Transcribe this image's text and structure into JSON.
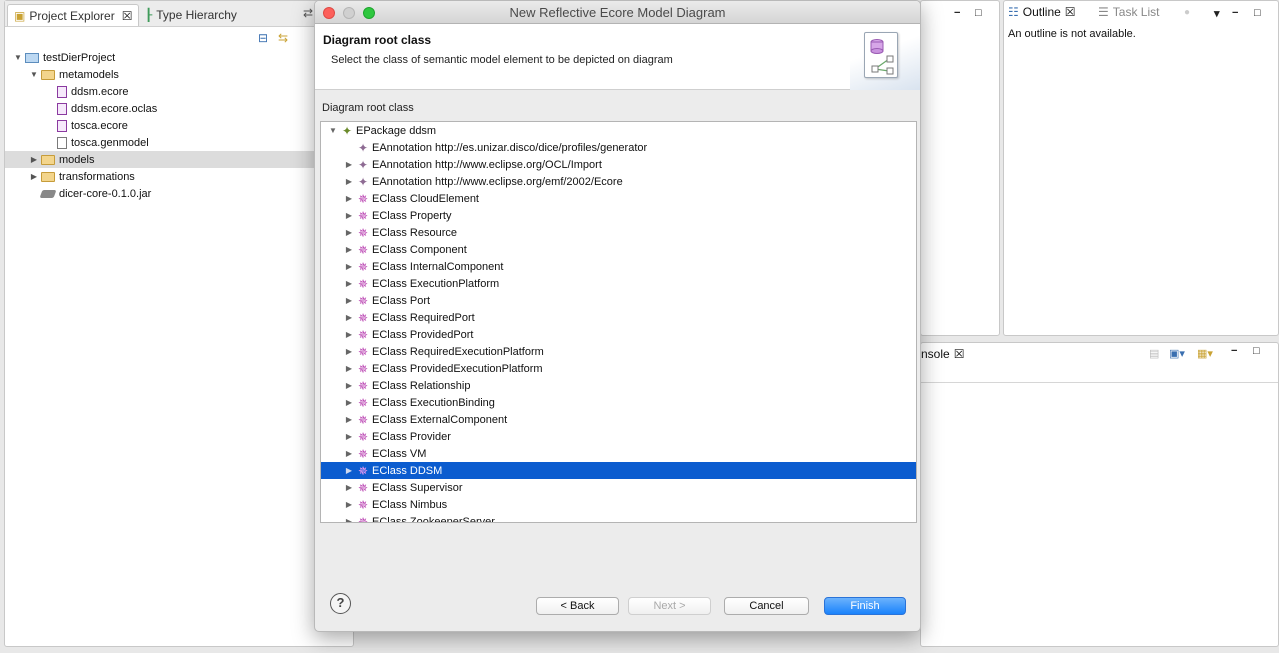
{
  "ide": {
    "left_tabs": [
      {
        "label": "Project Explorer",
        "icon": "project-explorer-icon",
        "active": true
      },
      {
        "label": "Type Hierarchy",
        "icon": "type-hierarchy-icon",
        "active": false
      }
    ],
    "explorer_tree": [
      {
        "label": "testDierProject",
        "level": 0,
        "twisty": "expanded",
        "icon": "project-icon"
      },
      {
        "label": "metamodels",
        "level": 1,
        "twisty": "expanded",
        "icon": "folder-icon"
      },
      {
        "label": "ddsm.ecore",
        "level": 2,
        "twisty": "none",
        "icon": "ecore-file-icon"
      },
      {
        "label": "ddsm.ecore.oclas",
        "level": 2,
        "twisty": "none",
        "icon": "ecore-diagram-icon"
      },
      {
        "label": "tosca.ecore",
        "level": 2,
        "twisty": "none",
        "icon": "ecore-file-icon"
      },
      {
        "label": "tosca.genmodel",
        "level": 2,
        "twisty": "none",
        "icon": "genmodel-file-icon"
      },
      {
        "label": "models",
        "level": 1,
        "twisty": "collapsed",
        "icon": "folder-icon",
        "highlight": true
      },
      {
        "label": "transformations",
        "level": 1,
        "twisty": "collapsed",
        "icon": "folder-icon"
      },
      {
        "label": "dicer-core-0.1.0.jar",
        "level": 1,
        "twisty": "none",
        "icon": "jar-icon"
      }
    ],
    "right_tabs": [
      {
        "label": "Outline",
        "active": true
      },
      {
        "label": "Task List",
        "active": false
      }
    ],
    "outline_message": "An outline is not available.",
    "console_tab_label": "nsole"
  },
  "dialog": {
    "window_title": "New Reflective Ecore Model Diagram",
    "banner_title": "Diagram root class",
    "banner_description": "Select the class of semantic model element to be depicted on diagram",
    "section_label": "Diagram root class",
    "tree": [
      {
        "label": "EPackage ddsm",
        "level": 0,
        "twisty": "expanded",
        "kind": "package"
      },
      {
        "label": "EAnnotation http://es.unizar.disco/dice/profiles/generator",
        "level": 1,
        "twisty": "none",
        "kind": "annotation"
      },
      {
        "label": "EAnnotation http://www.eclipse.org/OCL/Import",
        "level": 1,
        "twisty": "collapsed",
        "kind": "annotation"
      },
      {
        "label": "EAnnotation http://www.eclipse.org/emf/2002/Ecore",
        "level": 1,
        "twisty": "collapsed",
        "kind": "annotation"
      },
      {
        "label": "EClass CloudElement",
        "level": 1,
        "twisty": "collapsed",
        "kind": "class"
      },
      {
        "label": "EClass Property",
        "level": 1,
        "twisty": "collapsed",
        "kind": "class"
      },
      {
        "label": "EClass Resource",
        "level": 1,
        "twisty": "collapsed",
        "kind": "class"
      },
      {
        "label": "EClass Component",
        "level": 1,
        "twisty": "collapsed",
        "kind": "class"
      },
      {
        "label": "EClass InternalComponent",
        "level": 1,
        "twisty": "collapsed",
        "kind": "class"
      },
      {
        "label": "EClass ExecutionPlatform",
        "level": 1,
        "twisty": "collapsed",
        "kind": "class"
      },
      {
        "label": "EClass Port",
        "level": 1,
        "twisty": "collapsed",
        "kind": "class"
      },
      {
        "label": "EClass RequiredPort",
        "level": 1,
        "twisty": "collapsed",
        "kind": "class"
      },
      {
        "label": "EClass ProvidedPort",
        "level": 1,
        "twisty": "collapsed",
        "kind": "class"
      },
      {
        "label": "EClass RequiredExecutionPlatform",
        "level": 1,
        "twisty": "collapsed",
        "kind": "class"
      },
      {
        "label": "EClass ProvidedExecutionPlatform",
        "level": 1,
        "twisty": "collapsed",
        "kind": "class"
      },
      {
        "label": "EClass Relationship",
        "level": 1,
        "twisty": "collapsed",
        "kind": "class"
      },
      {
        "label": "EClass ExecutionBinding",
        "level": 1,
        "twisty": "collapsed",
        "kind": "class"
      },
      {
        "label": "EClass ExternalComponent",
        "level": 1,
        "twisty": "collapsed",
        "kind": "class"
      },
      {
        "label": "EClass Provider",
        "level": 1,
        "twisty": "collapsed",
        "kind": "class"
      },
      {
        "label": "EClass VM",
        "level": 1,
        "twisty": "collapsed",
        "kind": "class"
      },
      {
        "label": "EClass DDSM",
        "level": 1,
        "twisty": "collapsed",
        "kind": "class",
        "selected": true
      },
      {
        "label": "EClass Supervisor",
        "level": 1,
        "twisty": "collapsed",
        "kind": "class"
      },
      {
        "label": "EClass Nimbus",
        "level": 1,
        "twisty": "collapsed",
        "kind": "class"
      },
      {
        "label": "EClass ZookeeperServer",
        "level": 1,
        "twisty": "collapsed",
        "kind": "class"
      }
    ],
    "buttons": {
      "back": "< Back",
      "next": "Next >",
      "cancel": "Cancel",
      "finish": "Finish"
    },
    "help_symbol": "?"
  },
  "colors": {
    "selection": "#0b5ccf",
    "finish_button": "#1a82fb",
    "eclass_icon": "#b83eb0"
  }
}
